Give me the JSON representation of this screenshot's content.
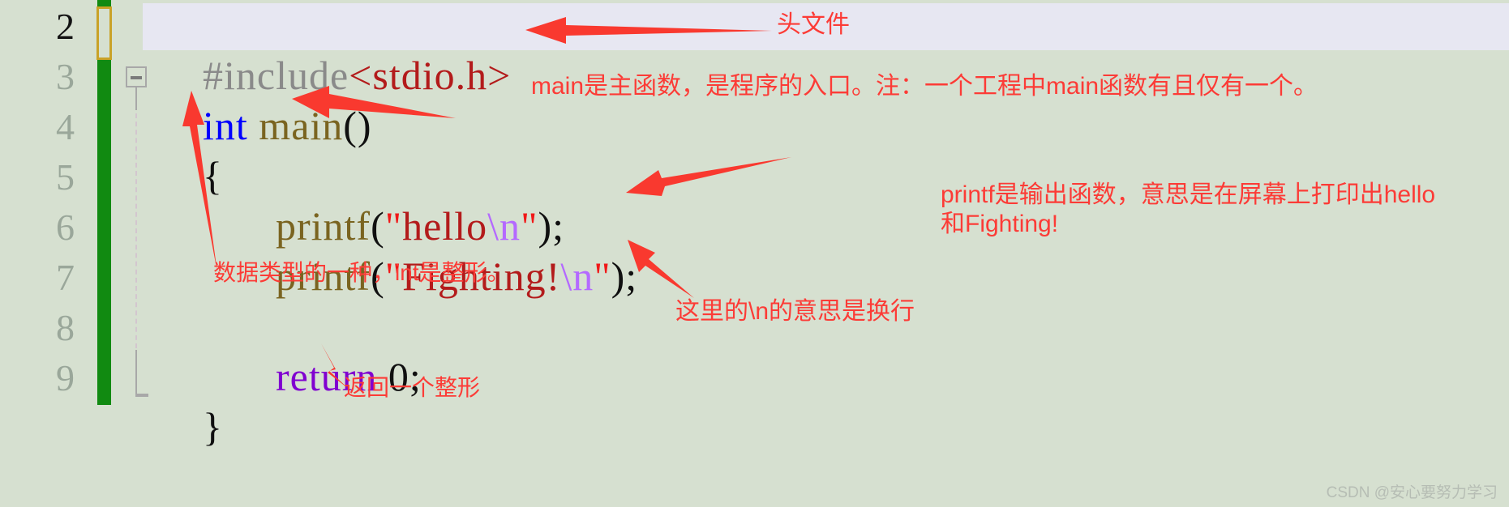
{
  "editor": {
    "background_color": "#d6e0d0",
    "highlight_color": "#e7e7f2",
    "changebar_color": "#118a11",
    "editmark_color": "#c9a227",
    "annotation_color": "#fc3b36",
    "line_numbers": [
      "2",
      "3",
      "4",
      "5",
      "6",
      "7",
      "8",
      "9"
    ],
    "lines": [
      {
        "number": "2",
        "tokens": [
          {
            "t": "#include",
            "c": "preproc"
          },
          {
            "t": "<stdio.h>",
            "c": "header"
          }
        ]
      },
      {
        "number": "3",
        "tokens": [
          {
            "t": "int",
            "c": "keyword"
          },
          {
            "t": " ",
            "c": "plain"
          },
          {
            "t": "main",
            "c": "function"
          },
          {
            "t": "()",
            "c": "punct"
          }
        ]
      },
      {
        "number": "4",
        "tokens": [
          {
            "t": "{",
            "c": "punct"
          }
        ]
      },
      {
        "number": "5",
        "tokens": [
          {
            "t": "printf",
            "c": "function"
          },
          {
            "t": "(",
            "c": "punct"
          },
          {
            "t": "\"",
            "c": "quote"
          },
          {
            "t": "hello",
            "c": "string"
          },
          {
            "t": "\\n",
            "c": "escape"
          },
          {
            "t": "\"",
            "c": "quote"
          },
          {
            "t": ");",
            "c": "punct"
          }
        ]
      },
      {
        "number": "6",
        "tokens": [
          {
            "t": "printf",
            "c": "function"
          },
          {
            "t": "(",
            "c": "punct"
          },
          {
            "t": "\"",
            "c": "quote"
          },
          {
            "t": "Fighting!",
            "c": "string"
          },
          {
            "t": "\\n",
            "c": "escape"
          },
          {
            "t": "\"",
            "c": "quote"
          },
          {
            "t": ");",
            "c": "punct"
          }
        ]
      },
      {
        "number": "7",
        "tokens": []
      },
      {
        "number": "8",
        "tokens": [
          {
            "t": "return",
            "c": "return"
          },
          {
            "t": " ",
            "c": "plain"
          },
          {
            "t": "0;",
            "c": "punct"
          }
        ]
      },
      {
        "number": "9",
        "tokens": [
          {
            "t": "}",
            "c": "punct"
          }
        ]
      }
    ],
    "code_text": {
      "l2_include": "#include",
      "l2_header": "<stdio.h>",
      "l3_int": "int",
      "l3_space": " ",
      "l3_main": "main",
      "l3_parens": "()",
      "l4_brace": "{",
      "l5_printf": "printf",
      "l5_open": "(",
      "l5_q1": "\"",
      "l5_str": "hello",
      "l5_esc": "\\n",
      "l5_q2": "\"",
      "l5_close": ");",
      "l6_printf": "printf",
      "l6_open": "(",
      "l6_q1": "\"",
      "l6_str": "Fighting!",
      "l6_esc": "\\n",
      "l6_q2": "\"",
      "l6_close": ");",
      "l8_return": "return",
      "l8_space": " ",
      "l8_zero": "0;",
      "l9_brace": "}"
    }
  },
  "annotations": {
    "header_file": "头文件",
    "main_function": "main是主函数，是程序的入口。注：一个工程中main函数有且仅有一个。",
    "printf_line1": "printf是输出函数，意思是在屏幕上打印出hello",
    "printf_line2": "和Fighting!",
    "int_type": "数据类型的一种，int是整形。",
    "newline": "这里的\\n的意思是换行",
    "return_int": "返回一个整形"
  },
  "watermark": {
    "text": "CSDN @安心要努力学习"
  }
}
